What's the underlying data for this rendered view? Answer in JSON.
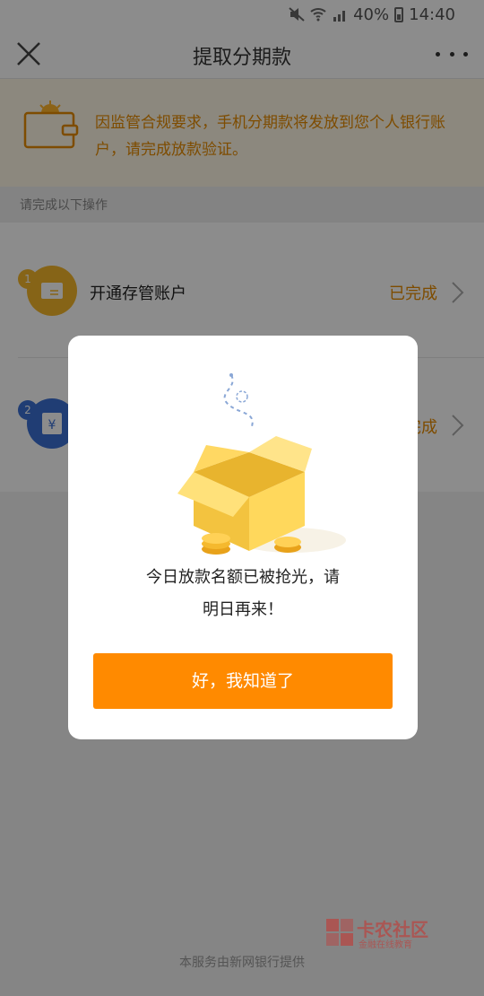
{
  "status_bar": {
    "battery": "40%",
    "time": "14:40"
  },
  "nav": {
    "title": "提取分期款"
  },
  "notice": {
    "text": "因监管合规要求，手机分期款将发放到您个人银行账户，请完成放款验证。"
  },
  "section": {
    "title": "请完成以下操作"
  },
  "steps": [
    {
      "number": "1",
      "label": "开通存管账户",
      "status": "已完成"
    },
    {
      "number": "2",
      "label": "",
      "status": "已完成"
    }
  ],
  "footer": {
    "text": "本服务由新网银行提供"
  },
  "watermark": {
    "name": "卡农社区",
    "slogan": "金融在线教育"
  },
  "modal": {
    "message_line1": "今日放款名额已被抢光，请",
    "message_line2": "明日再来！",
    "button_label": "好，我知道了"
  },
  "colors": {
    "accent": "#ff8a00",
    "notice_text": "#e58a00",
    "step2": "#3b6fd4"
  }
}
